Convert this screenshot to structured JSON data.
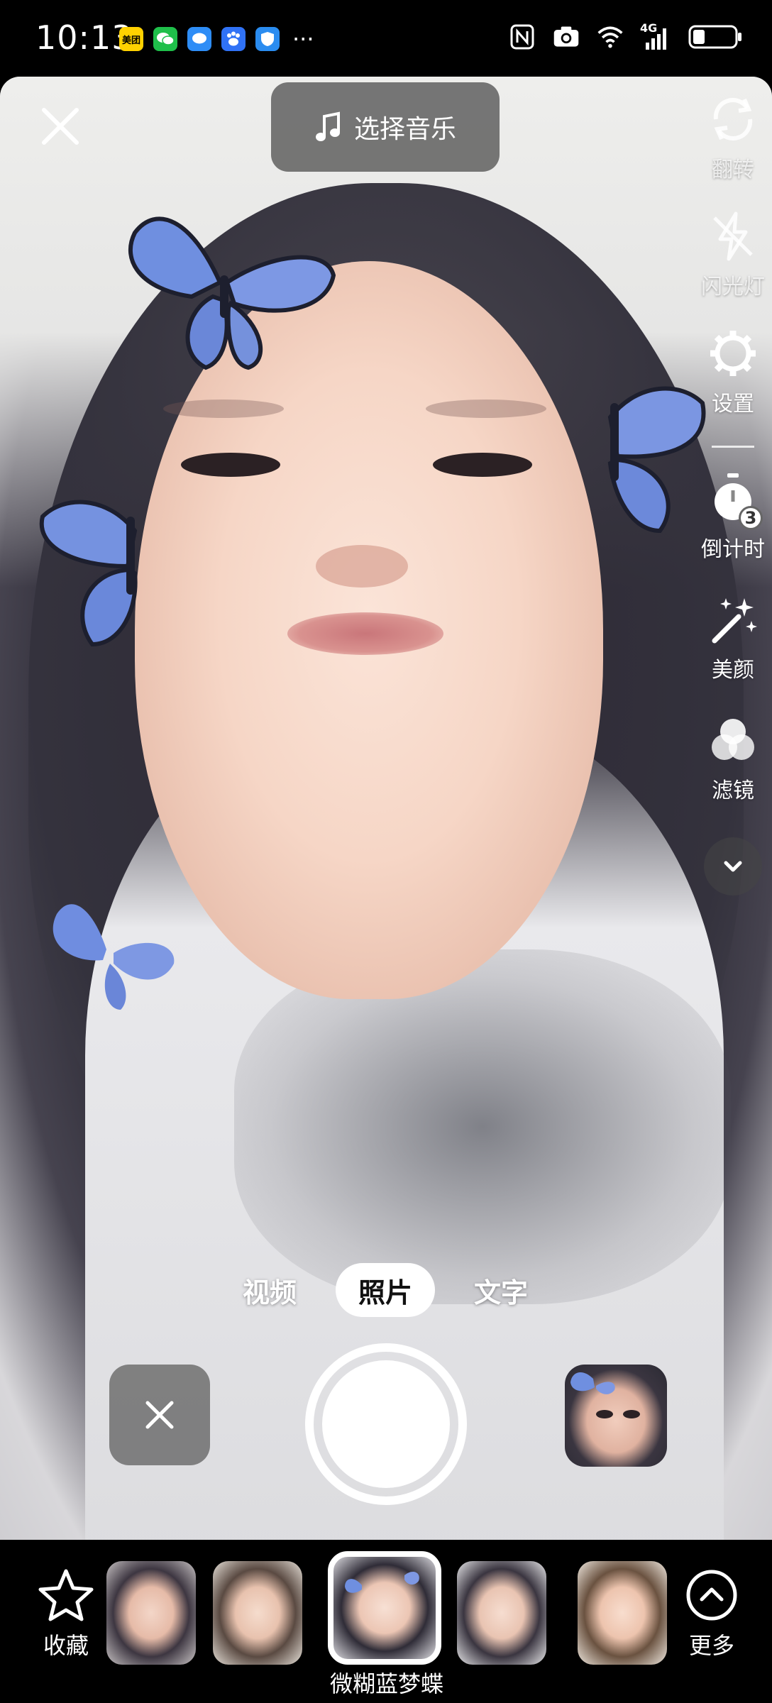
{
  "status_bar": {
    "time": "10:13",
    "notif_icons": [
      "meituan-icon",
      "wechat-icon",
      "message-icon",
      "baidu-icon",
      "shield-icon"
    ],
    "notif_badge_meituan": "美团",
    "more": "···",
    "network": "4G"
  },
  "top": {
    "music_label": "选择音乐"
  },
  "rail": {
    "flip_label": "翻转",
    "flash_label": "闪光灯",
    "settings_label": "设置",
    "timer_label": "倒计时",
    "timer_badge": "3",
    "beauty_label": "美颜",
    "filter_label": "滤镜"
  },
  "modes": {
    "video": "视频",
    "photo": "照片",
    "text": "文字",
    "active": "photo"
  },
  "bottom": {
    "favorite_label": "收藏",
    "more_label": "更多",
    "selected_effect_name": "微糊蓝梦蝶"
  },
  "colors": {
    "accent": "#ffffff",
    "butterfly": "#6f8fe0"
  }
}
